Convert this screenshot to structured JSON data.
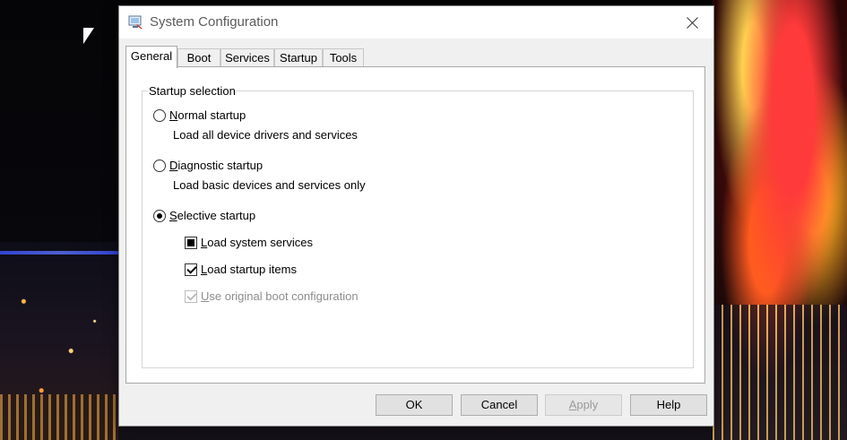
{
  "window": {
    "title": "System Configuration",
    "icon": "msconfig-icon"
  },
  "tabs": [
    {
      "label": "General",
      "active": true
    },
    {
      "label": "Boot",
      "active": false
    },
    {
      "label": "Services",
      "active": false
    },
    {
      "label": "Startup",
      "active": false
    },
    {
      "label": "Tools",
      "active": false
    }
  ],
  "startup_selection": {
    "legend": "Startup selection",
    "normal": {
      "label": "Normal startup",
      "underline": "N",
      "rest": "ormal startup",
      "description": "Load all device drivers and services",
      "selected": false
    },
    "diagnostic": {
      "label": "Diagnostic startup",
      "underline": "D",
      "rest": "iagnostic startup",
      "description": "Load basic devices and services only",
      "selected": false
    },
    "selective": {
      "label": "Selective startup",
      "underline": "S",
      "rest": "elective startup",
      "selected": true
    },
    "options": [
      {
        "label": "Load system services",
        "underline": "L",
        "rest": "oad system services",
        "state": "indeterminate",
        "enabled": true
      },
      {
        "label": "Load startup items",
        "underline": "L",
        "rest": "oad startup items",
        "state": "checked",
        "enabled": true
      },
      {
        "label": "Use original boot configuration",
        "underline": "U",
        "rest": "se original boot configuration",
        "state": "checked",
        "enabled": false
      }
    ]
  },
  "buttons": {
    "ok": "OK",
    "cancel": "Cancel",
    "apply": "Apply",
    "apply_underline": "A",
    "apply_rest": "pply",
    "help": "Help"
  },
  "colors": {
    "dialog_bg": "#f0f0f0",
    "panel_bg": "#ffffff",
    "disabled_text": "#8d8d8d"
  }
}
